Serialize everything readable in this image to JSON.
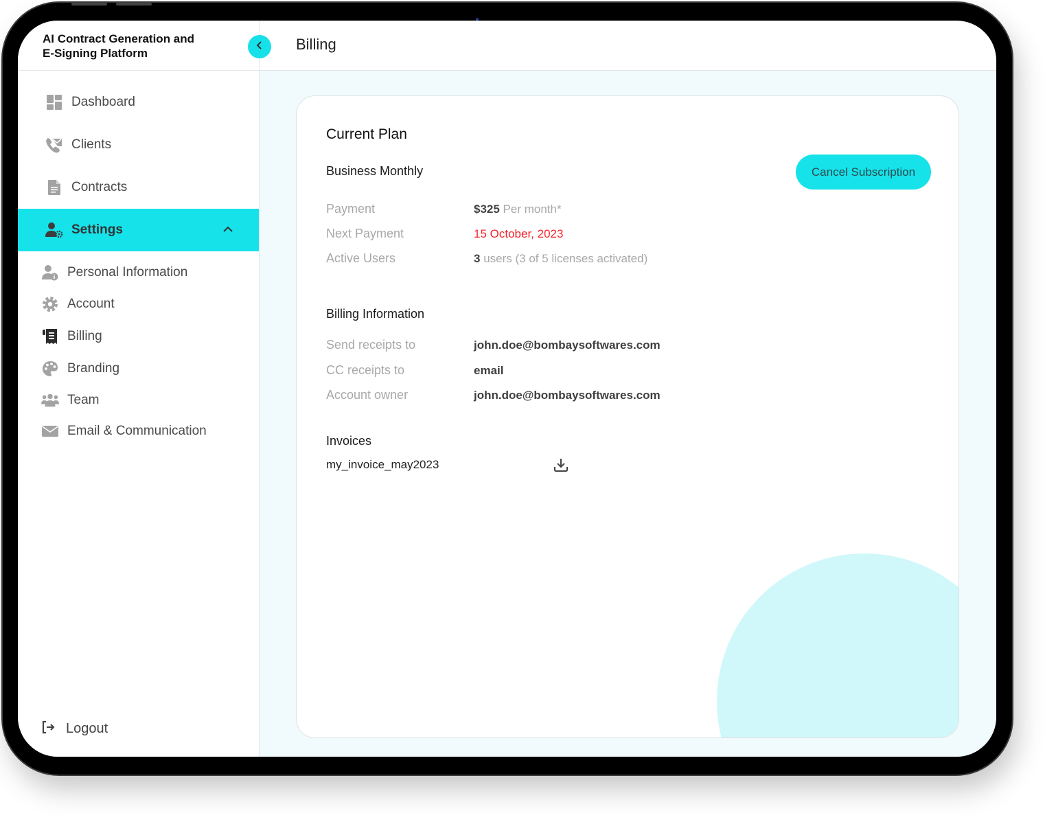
{
  "app": {
    "title": "AI Contract Generation and E-Signing Platform",
    "title_line1": "AI Contract Generation and",
    "title_line2": "E-Signing Platform"
  },
  "header": {
    "page_title": "Billing",
    "collapse_icon": "chevron-left-icon"
  },
  "sidebar": {
    "items": [
      {
        "label": "Dashboard",
        "icon": "dashboard-icon"
      },
      {
        "label": "Clients",
        "icon": "clients-icon"
      },
      {
        "label": "Contracts",
        "icon": "document-icon"
      },
      {
        "label": "Settings",
        "icon": "user-settings-icon",
        "active": true,
        "expanded": true
      }
    ],
    "settings_subitems": [
      {
        "label": "Personal Information",
        "icon": "user-info-icon"
      },
      {
        "label": "Account",
        "icon": "gear-icon"
      },
      {
        "label": "Billing",
        "icon": "receipt-icon",
        "active": true
      },
      {
        "label": "Branding",
        "icon": "palette-icon"
      },
      {
        "label": "Team",
        "icon": "team-icon"
      },
      {
        "label": "Email & Communication",
        "icon": "envelope-icon"
      }
    ],
    "logout_label": "Logout"
  },
  "current_plan": {
    "heading": "Current Plan",
    "plan_name": "Business Monthly",
    "cancel_label": "Cancel Subscription",
    "rows": [
      {
        "label": "Payment",
        "value_strong": "$325",
        "value_rest": " Per month*"
      },
      {
        "label": "Next Payment",
        "value": "15 October, 2023"
      },
      {
        "label": "Active Users",
        "value_strong": "3",
        "value_rest": " users (3 of 5 licenses activated)"
      }
    ]
  },
  "billing_information": {
    "heading": "Billing Information",
    "rows": [
      {
        "label": "Send receipts to",
        "value": "john.doe@bombaysoftwares.com"
      },
      {
        "label": "CC receipts to",
        "value": "email"
      },
      {
        "label": "Account owner",
        "value": "john.doe@bombaysoftwares.com"
      }
    ]
  },
  "invoices": {
    "heading": "Invoices",
    "items": [
      {
        "name": "my_invoice_may2023",
        "action_icon": "download-icon"
      }
    ]
  },
  "colors": {
    "accent": "#16e2ea",
    "danger": "#f2232b",
    "background": "#f1fafc",
    "decor": "#d0f8fa"
  }
}
